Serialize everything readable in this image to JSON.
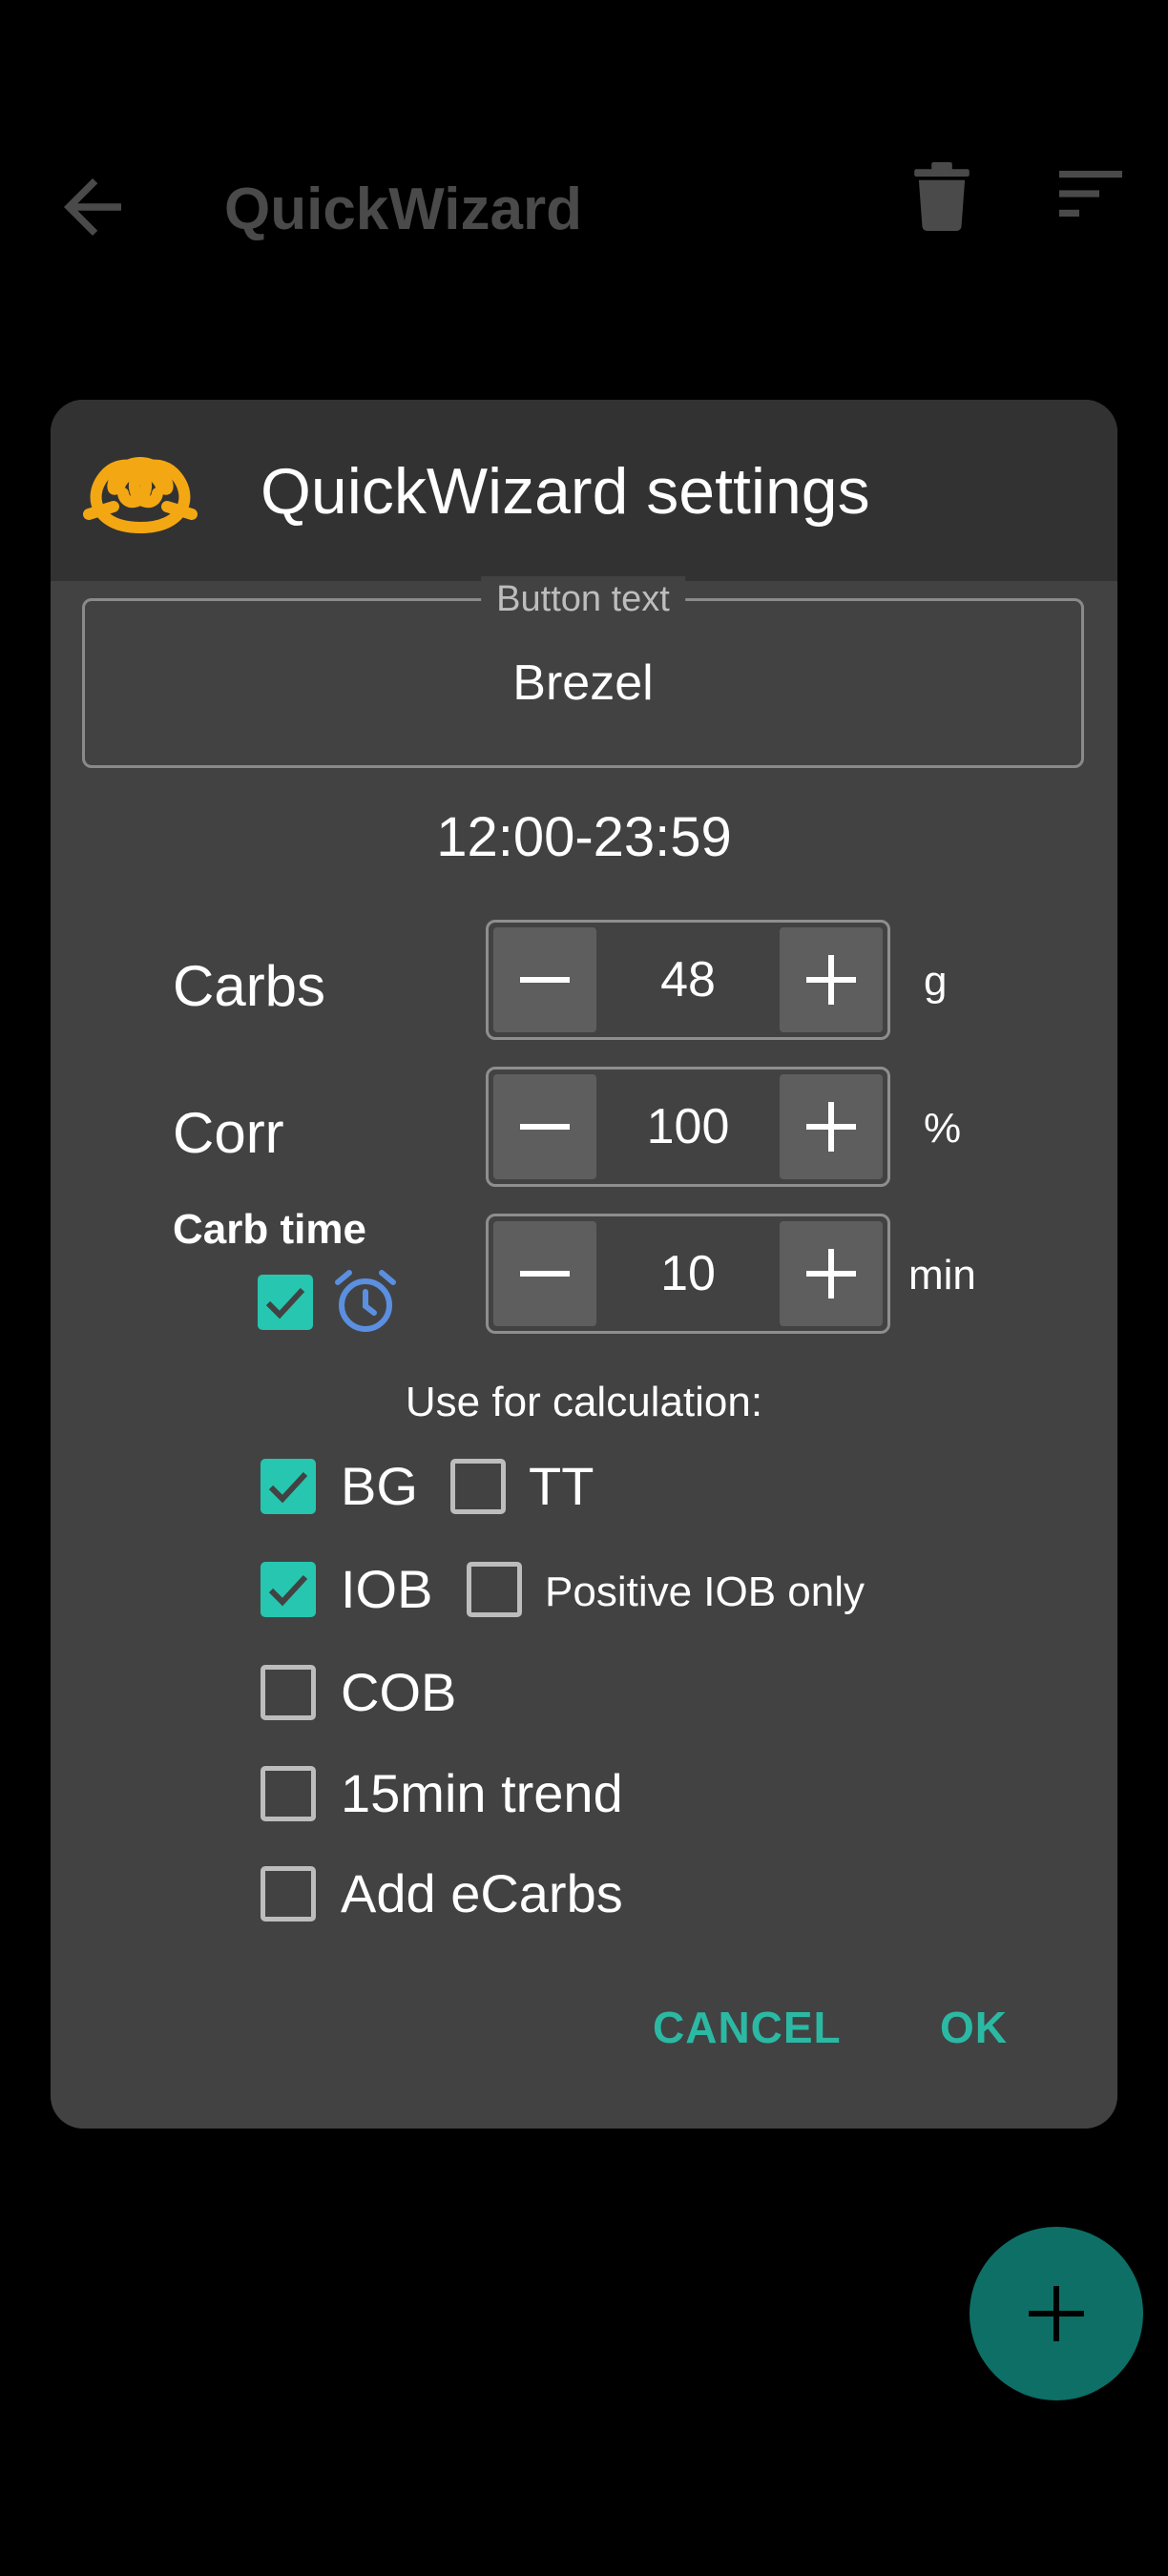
{
  "appbar": {
    "title": "QuickWizard",
    "icons": [
      "arrow-back-icon",
      "trash-icon",
      "sort-icon"
    ]
  },
  "dialog": {
    "title": "QuickWizard settings",
    "icon": "pretzel-icon",
    "button_text": {
      "label": "Button text",
      "value": "Brezel"
    },
    "time_range": "12:00-23:59",
    "carbs": {
      "label": "Carbs",
      "value": "48",
      "unit": "g"
    },
    "corr": {
      "label": "Corr",
      "value": "100",
      "unit": "%"
    },
    "carb_time": {
      "label": "Carb time",
      "value": "10",
      "unit": "min",
      "alarm_checked": true
    },
    "calc_title": "Use for calculation:",
    "options": {
      "bg": {
        "label": "BG",
        "checked": true
      },
      "tt": {
        "label": "TT",
        "checked": false
      },
      "iob": {
        "label": "IOB",
        "checked": true
      },
      "positive_iob": {
        "label": "Positive IOB only",
        "checked": false
      },
      "cob": {
        "label": "COB",
        "checked": false
      },
      "trend": {
        "label": "15min trend",
        "checked": false
      },
      "ecarbs": {
        "label": "Add eCarbs",
        "checked": false
      }
    },
    "cancel_label": "CANCEL",
    "ok_label": "OK"
  },
  "fab": {
    "icon": "plus-icon"
  },
  "colors": {
    "accent": "#26c6b0",
    "dialog_bg": "#424242",
    "header_bg": "#323232",
    "fab_bg": "#0e6f66",
    "pretzel": "#f3a712",
    "alarm": "#5b8fe0"
  }
}
